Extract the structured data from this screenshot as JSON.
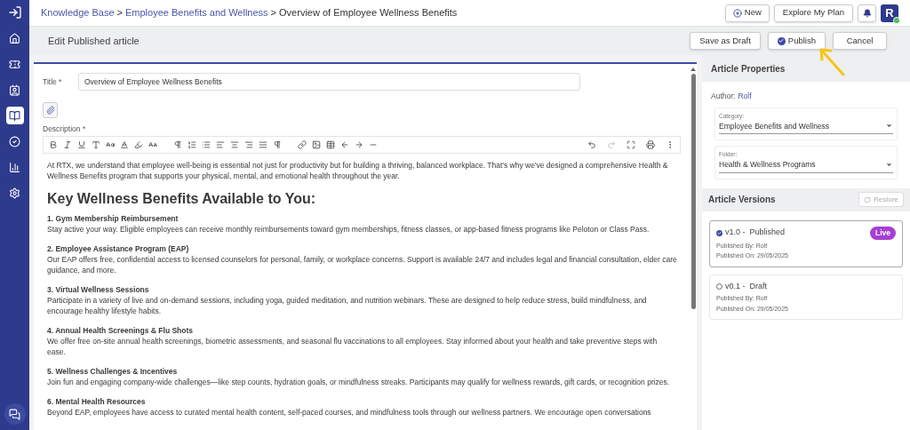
{
  "sidebar": {
    "items": [
      {
        "kind": "home",
        "selected": false
      },
      {
        "kind": "ticket",
        "selected": false
      },
      {
        "kind": "contact",
        "selected": false
      },
      {
        "kind": "knowledge",
        "selected": true
      },
      {
        "kind": "task",
        "selected": false
      },
      {
        "kind": "report",
        "selected": false
      },
      {
        "kind": "settings",
        "selected": false
      }
    ]
  },
  "breadcrumb": {
    "links": [
      "Knowledge Base",
      "Employee Benefits and Wellness"
    ],
    "separator": ">",
    "current": "Overview of Employee Wellness Benefits"
  },
  "top_actions": {
    "new": "New",
    "plan": "Explore My Plan",
    "avatar": "R"
  },
  "header": {
    "title": "Edit Published article",
    "buttons": [
      {
        "label": "Save as Draft",
        "kind": "plain"
      },
      {
        "label": "Publish",
        "kind": "primary"
      },
      {
        "label": "Cancel",
        "kind": "plain"
      }
    ]
  },
  "editor": {
    "title_label": "Title *",
    "title_value": "Overview of Employee Wellness Benefits",
    "description_label": "Description *",
    "intro": "At RTX, we understand that employee well-being is essential not just for productivity but for building a thriving, balanced workplace. That's why we've designed a comprehensive Health & Wellness Benefits program that supports your physical, mental, and emotional health throughout the year.",
    "heading": "Key Wellness Benefits Available to You:",
    "sections": [
      {
        "title": "1. Gym Membership Reimbursement",
        "body": "Stay active your way. Eligible employees can receive monthly reimbursements toward gym memberships, fitness classes, or app-based fitness programs like Peloton or Class Pass."
      },
      {
        "title": "2. Employee Assistance Program (EAP)",
        "body": "Our EAP offers free, confidential access to licensed counselors for personal, family, or workplace concerns. Support is available 24/7 and includes legal and financial consultation, elder care guidance, and more."
      },
      {
        "title": "3. Virtual Wellness Sessions",
        "body": "Participate in a variety of live and on-demand sessions, including yoga, guided meditation, and nutrition webinars. These are designed to help reduce stress, build mindfulness, and encourage healthy lifestyle habits."
      },
      {
        "title": "4. Annual Health Screenings & Flu Shots",
        "body": "We offer free on-site annual health screenings, biometric assessments, and seasonal flu vaccinations to all employees. Stay informed about your health and take preventive steps with ease."
      },
      {
        "title": "5. Wellness Challenges & Incentives",
        "body": "Join fun and engaging company-wide challenges—like step counts, hydration goals, or mindfulness streaks. Participants may qualify for wellness rewards, gift cards, or recognition prizes."
      },
      {
        "title": "6. Mental Health Resources",
        "body": "Beyond EAP, employees have access to curated mental health content, self-paced courses, and mindfulness tools through our wellness partners. We encourage open conversations"
      }
    ]
  },
  "properties": {
    "title": "Article Properties",
    "author_label": "Author:",
    "author": "Rolf",
    "fields": [
      {
        "label": "Category:",
        "value": "Employee Benefits and Wellness"
      },
      {
        "label": "Folder:",
        "value": "Health & Wellness Programs"
      }
    ]
  },
  "versions": {
    "title": "Article Versions",
    "restore": "Restore",
    "restore_disabled": true,
    "items": [
      {
        "version": "v1.0 -",
        "status": "Published",
        "by": "Published By: Rolf",
        "on": "Published On: 29/05/2025",
        "selected": true,
        "badge": "Live"
      },
      {
        "version": "v0.1 -",
        "status": "Draft",
        "by": "Published By: Rolf",
        "on": "Published On: 29/05/2025",
        "selected": false
      }
    ]
  }
}
